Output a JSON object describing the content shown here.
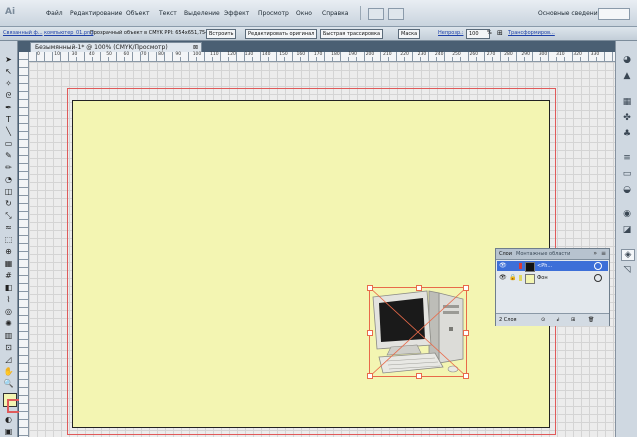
{
  "app": {
    "logo": "Ai"
  },
  "menu": [
    "Файл",
    "Редактирование",
    "Объект",
    "Текст",
    "Выделение",
    "Эффект",
    "Просмотр",
    "Окно",
    "Справка"
  ],
  "workspace": "Основные сведения ▾",
  "control_bar": {
    "file_link": "Связанный ф...",
    "filename_link": "компьютер_01.png",
    "info": "Прозрачный объект в CMYK  PPI: 654x651,754",
    "embed": "Встроить",
    "edit_original": "Редактировать оригинал",
    "live_trace": "Быстрая трассировка",
    "mask": "Маска",
    "opacity_label": "Непрозр.:",
    "opacity_value": "100",
    "opacity_unit": "%",
    "transform": "Трансформиров..."
  },
  "document_tab": {
    "title": "Безымянный-1* @ 100% (CMYK/Просмотр)",
    "close": "⊠"
  },
  "ruler_labels": [
    "0",
    "10",
    "30",
    "40",
    "50",
    "60",
    "70",
    "80",
    "90",
    "100",
    "110",
    "120",
    "130",
    "140",
    "150",
    "160",
    "170",
    "180",
    "190",
    "200",
    "210",
    "220",
    "230",
    "240",
    "250",
    "260",
    "270",
    "280",
    "290",
    "300",
    "310",
    "320",
    "330"
  ],
  "layers_panel": {
    "tab_layers": "Слои",
    "tab_other": "Монтажные области",
    "layers": [
      {
        "name": "<Ph...",
        "color": "#d63a3a",
        "selected": true,
        "locked": false
      },
      {
        "name": "Фон",
        "color": "#f3f5b2",
        "selected": false,
        "locked": true
      }
    ],
    "footer_count": "2 Слоя",
    "footer_icons": [
      "⊙",
      "↲",
      "⊞",
      "🗑"
    ]
  },
  "colors": {
    "artboard": "#f3f5b2",
    "selection": "#e86a4a",
    "bleed": "#e05a5a"
  }
}
